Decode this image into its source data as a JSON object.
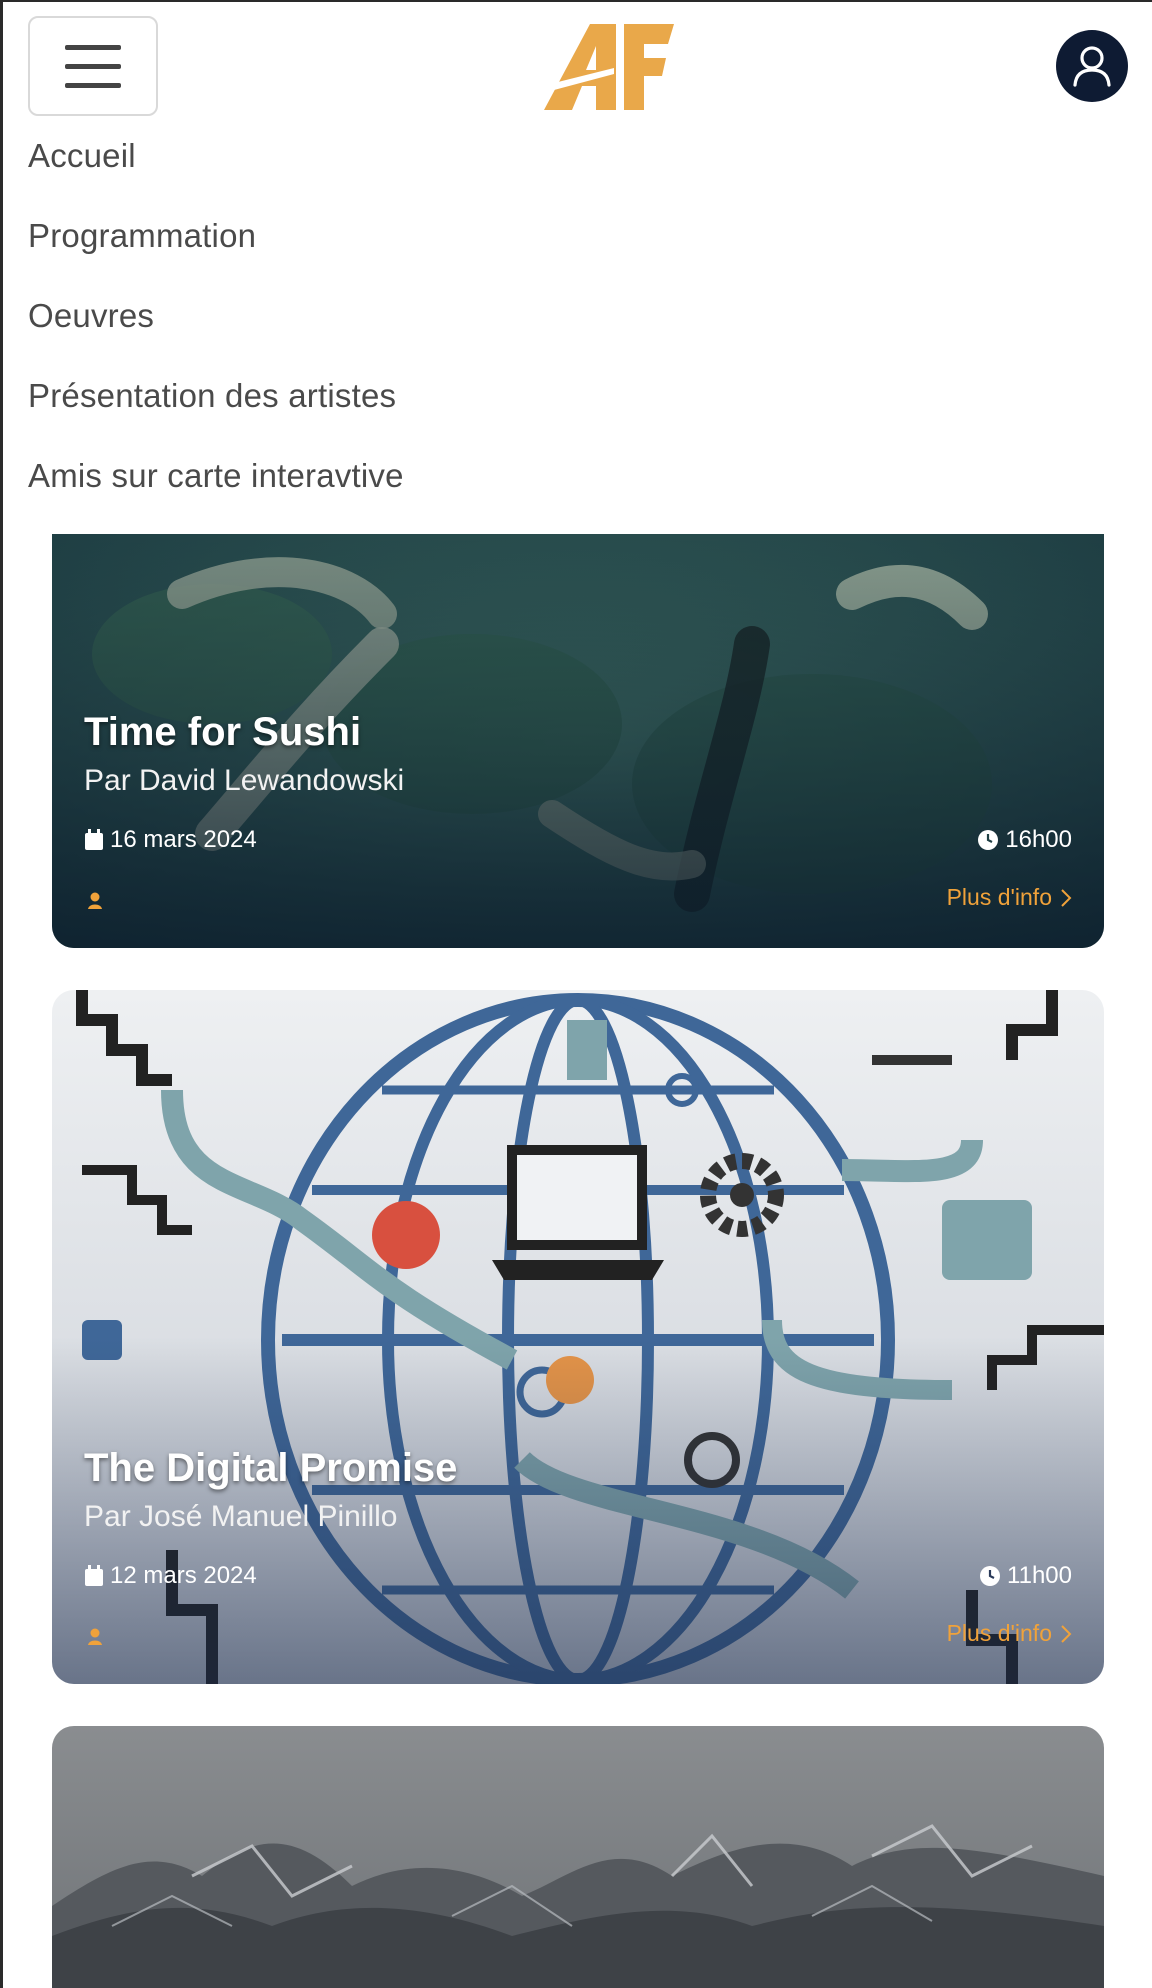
{
  "header": {
    "logo_text": "AF",
    "menu_icon": "hamburger-icon",
    "account_icon": "user-icon"
  },
  "nav": {
    "items": [
      {
        "label": "Accueil"
      },
      {
        "label": "Programmation"
      },
      {
        "label": "Oeuvres"
      },
      {
        "label": "Présentation des artistes"
      },
      {
        "label": "Amis sur carte interavtive"
      }
    ]
  },
  "events": [
    {
      "title": "Time for Sushi",
      "author": "Par David Lewandowski",
      "date": "16 mars 2024",
      "time": "16h00",
      "more_label": "Plus d'info"
    },
    {
      "title": "The Digital Promise",
      "author": "Par José Manuel Pinillo",
      "date": "12 mars 2024",
      "time": "11h00",
      "more_label": "Plus d'info"
    }
  ],
  "colors": {
    "accent": "#f0a23a",
    "logo": "#e9a84a",
    "avatar_bg": "#0e1b33",
    "nav_text": "#4a4a4a"
  }
}
